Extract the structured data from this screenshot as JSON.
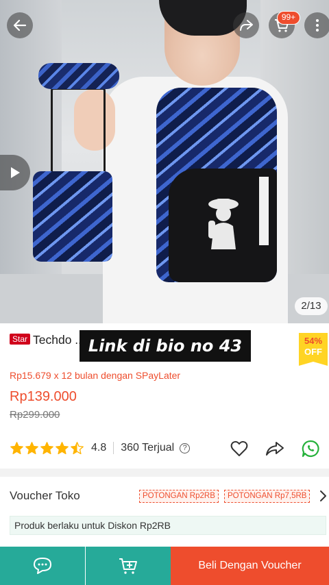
{
  "header": {
    "back_icon": "arrow-left-icon",
    "share_icon": "share-arrow-icon",
    "cart_icon": "shopping-cart-icon",
    "cart_badge": "99+",
    "more_icon": "more-vertical-icon"
  },
  "gallery": {
    "video_icon": "play-icon",
    "counter": "2/13"
  },
  "product": {
    "tag": "Star",
    "title": "Techdo ... ah Tas Backpack W... aptop...",
    "discount_percent": "54%",
    "discount_suffix": "OFF",
    "overlay_text": "Link di bio no 43",
    "paylater": "Rp15.679 x 12 bulan dengan SPayLater",
    "price": "Rp139.000",
    "original_price": "Rp299.000",
    "rating": "4.8",
    "stars_filled": 4.5,
    "sold": "360 Terjual",
    "help_icon": "question-icon",
    "favorite_icon": "heart-icon",
    "share_icon": "share-icon",
    "whatsapp_icon": "whatsapp-icon"
  },
  "voucher": {
    "label": "Voucher Toko",
    "tags": [
      "POTONGAN Rp2RB",
      "POTONGAN Rp7,5RB"
    ],
    "note": "Produk berlaku untuk Diskon Rp2RB"
  },
  "bottom_bar": {
    "chat_icon": "chat-icon",
    "add_cart_icon": "add-to-cart-icon",
    "buy_label": "Beli Dengan Voucher"
  },
  "colors": {
    "accent": "#ee4d2d",
    "teal": "#26aa99",
    "star": "#ffb400",
    "whatsapp": "#25b13a"
  }
}
